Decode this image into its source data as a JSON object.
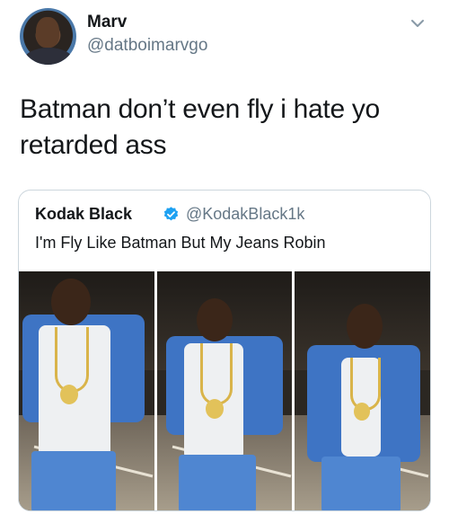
{
  "author": {
    "name": "Marv",
    "handle": "@datboimarvgo",
    "avatar_icon": "user-avatar"
  },
  "menu_icon": "chevron-down-icon",
  "tweet": {
    "text_line1": "Batman don’t even fly i hate yo",
    "text_line2": "retarded ass"
  },
  "quoted_tweet": {
    "name": "Kodak Black",
    "verified_icon": "verified-badge-icon",
    "handle": "@KodakBlack1k",
    "text": "I'm Fly Like Batman But My Jeans Robin",
    "photos": [
      {
        "label": "photo-1"
      },
      {
        "label": "photo-2"
      },
      {
        "label": "photo-3"
      }
    ]
  },
  "colors": {
    "text": "#14171a",
    "secondary": "#657786",
    "verified": "#1da1f2",
    "border": "#ccd6dd"
  }
}
